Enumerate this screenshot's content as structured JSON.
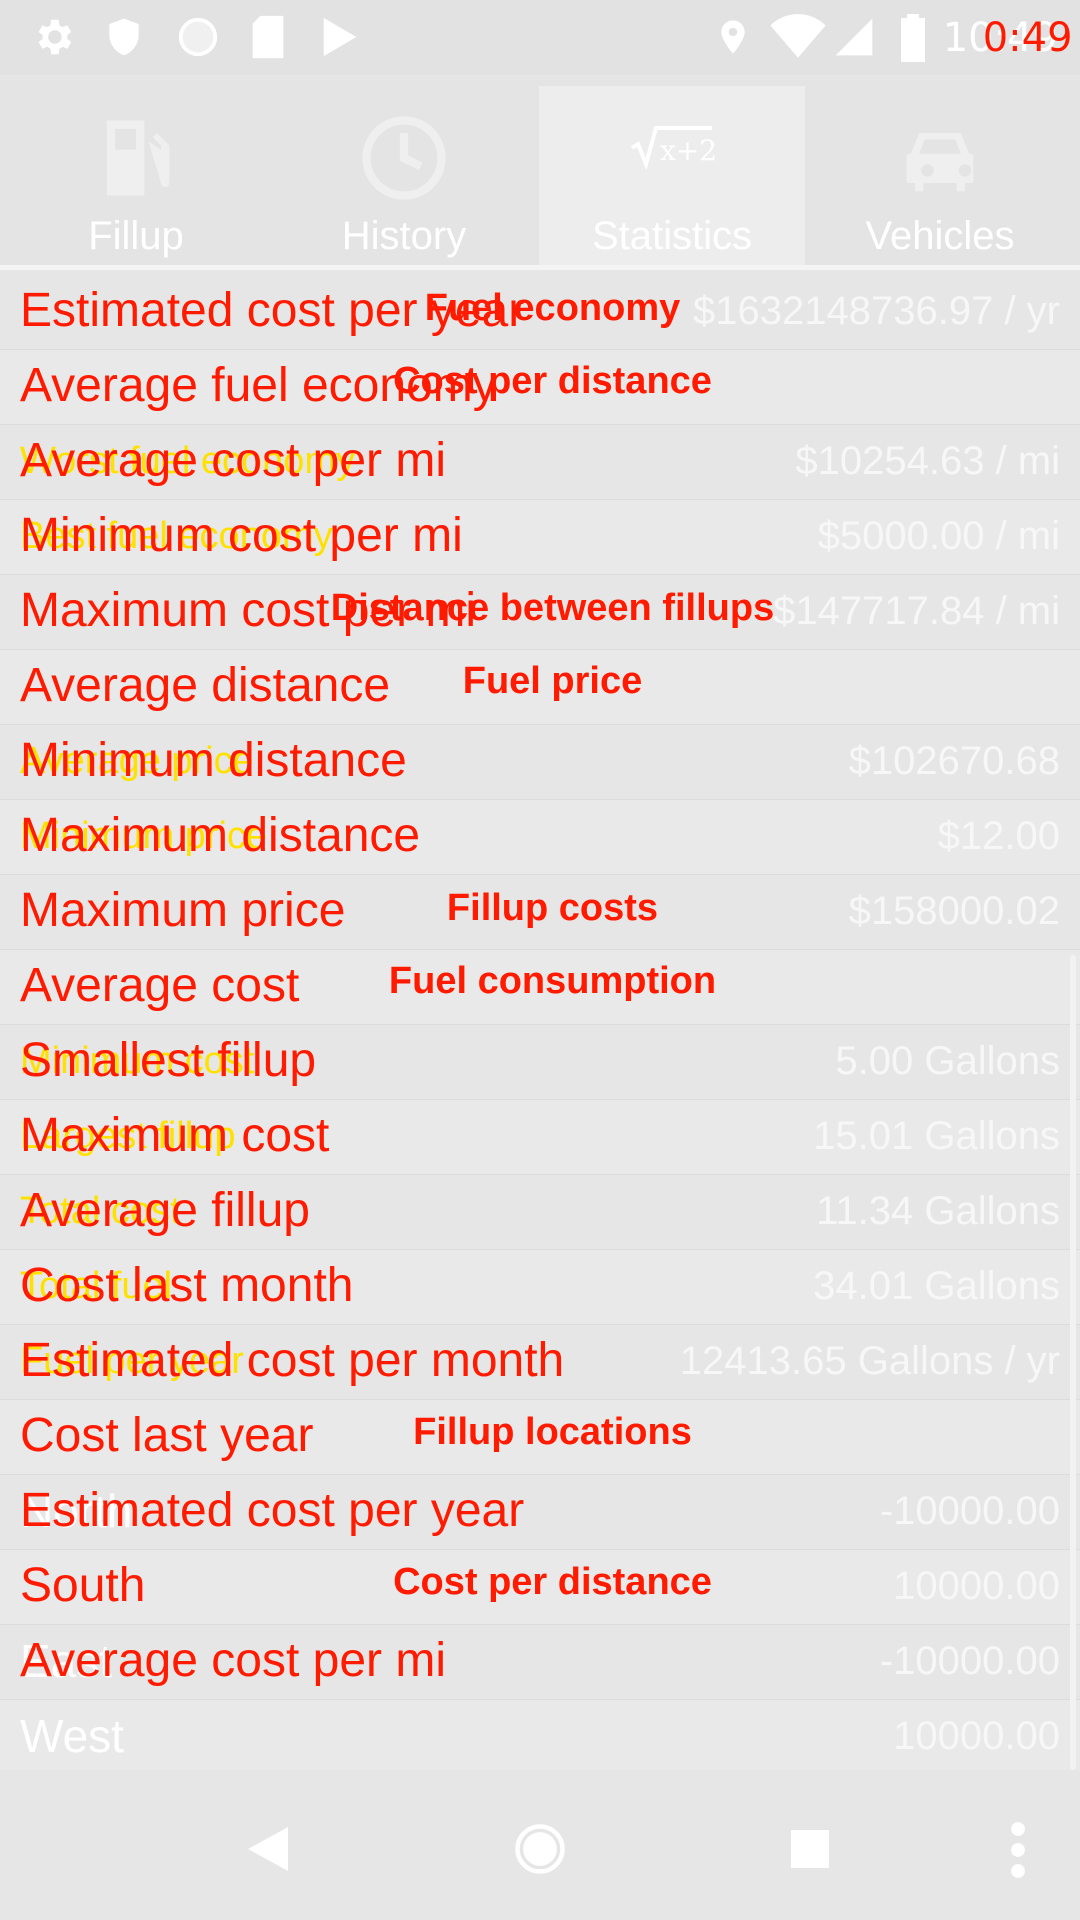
{
  "status_bar": {
    "time_overlay": "0:49",
    "time_base": "10:49",
    "icons": [
      "gear-icon",
      "shield-icon",
      "circle-icon",
      "sdcard-icon",
      "play-store-icon",
      "location-icon",
      "wifi-icon",
      "signal-icon",
      "battery-icon"
    ]
  },
  "tabs": [
    {
      "label": "Fillup",
      "icon": "fuel-pump-icon",
      "active": false
    },
    {
      "label": "History",
      "icon": "clock-icon",
      "active": false
    },
    {
      "label": "Statistics",
      "icon": "sqrt-formula-icon",
      "active": true
    },
    {
      "label": "Vehicles",
      "icon": "car-icon",
      "active": false
    }
  ],
  "sections": [
    {
      "title": "Fuel economy"
    },
    {
      "title": "Cost per distance"
    },
    {
      "title": "Distance between fillups"
    },
    {
      "title": "Fuel price"
    },
    {
      "title": "Fillup costs"
    },
    {
      "title": "Fuel consumption"
    },
    {
      "title": "Fillup locations"
    },
    {
      "title": "Cost per distance"
    }
  ],
  "rows": [
    {
      "red": "Estimated cost per year",
      "yellow": "",
      "white": "",
      "value": "$1632148736.97 / yr"
    },
    {
      "red": "Average fuel economy",
      "yellow": "",
      "white": "",
      "value": ""
    },
    {
      "red": "Average cost per mi",
      "yellow": "Worst fuel economy",
      "white": "",
      "value": "$10254.63 / mi"
    },
    {
      "red": "Minimum cost per mi",
      "yellow": "Best fuel economy",
      "white": "",
      "value": "$5000.00 / mi"
    },
    {
      "red": "Maximum cost per mi",
      "yellow": "",
      "white": "",
      "value": "$147717.84 / mi"
    },
    {
      "red": "Average distance",
      "yellow": "",
      "white": "",
      "value": ""
    },
    {
      "red": "Minimum distance",
      "yellow": "Average price",
      "white": "",
      "value": "$102670.68"
    },
    {
      "red": "Maximum distance",
      "yellow": "Minimum price",
      "white": "",
      "value": "$12.00"
    },
    {
      "red": "Maximum price",
      "yellow": "",
      "white": "",
      "value": "$158000.02"
    },
    {
      "red": "Average cost",
      "yellow": "",
      "white": "",
      "value": ""
    },
    {
      "red": "Smallest fillup",
      "yellow": "Minimum cost",
      "white": "",
      "value": "5.00 Gallons"
    },
    {
      "red": "Maximum cost",
      "yellow": "Largest fillup",
      "white": "",
      "value": "15.01 Gallons"
    },
    {
      "red": "Average fillup",
      "yellow": "Total cost",
      "white": "",
      "value": "11.34 Gallons"
    },
    {
      "red": "Cost last month",
      "yellow": "Total fuel",
      "white": "",
      "value": "34.01 Gallons"
    },
    {
      "red": "Estimated cost per month",
      "yellow": "Fuel per year",
      "white": "",
      "value": "12413.65 Gallons / yr"
    },
    {
      "red": "Cost last year",
      "yellow": "",
      "white": "",
      "value": ""
    },
    {
      "red": "Estimated cost per year",
      "yellow": "",
      "white": "North",
      "value": "-10000.00"
    },
    {
      "red": "South",
      "yellow": "",
      "white": "",
      "value": "10000.00"
    },
    {
      "red": "Average cost per mi",
      "yellow": "",
      "white": "East",
      "value": "-10000.00"
    },
    {
      "red": "",
      "yellow": "",
      "white": "West",
      "value": "10000.00"
    }
  ],
  "nav_bar": {
    "buttons": [
      "back-icon",
      "home-icon",
      "recents-icon",
      "more-options-icon"
    ]
  }
}
